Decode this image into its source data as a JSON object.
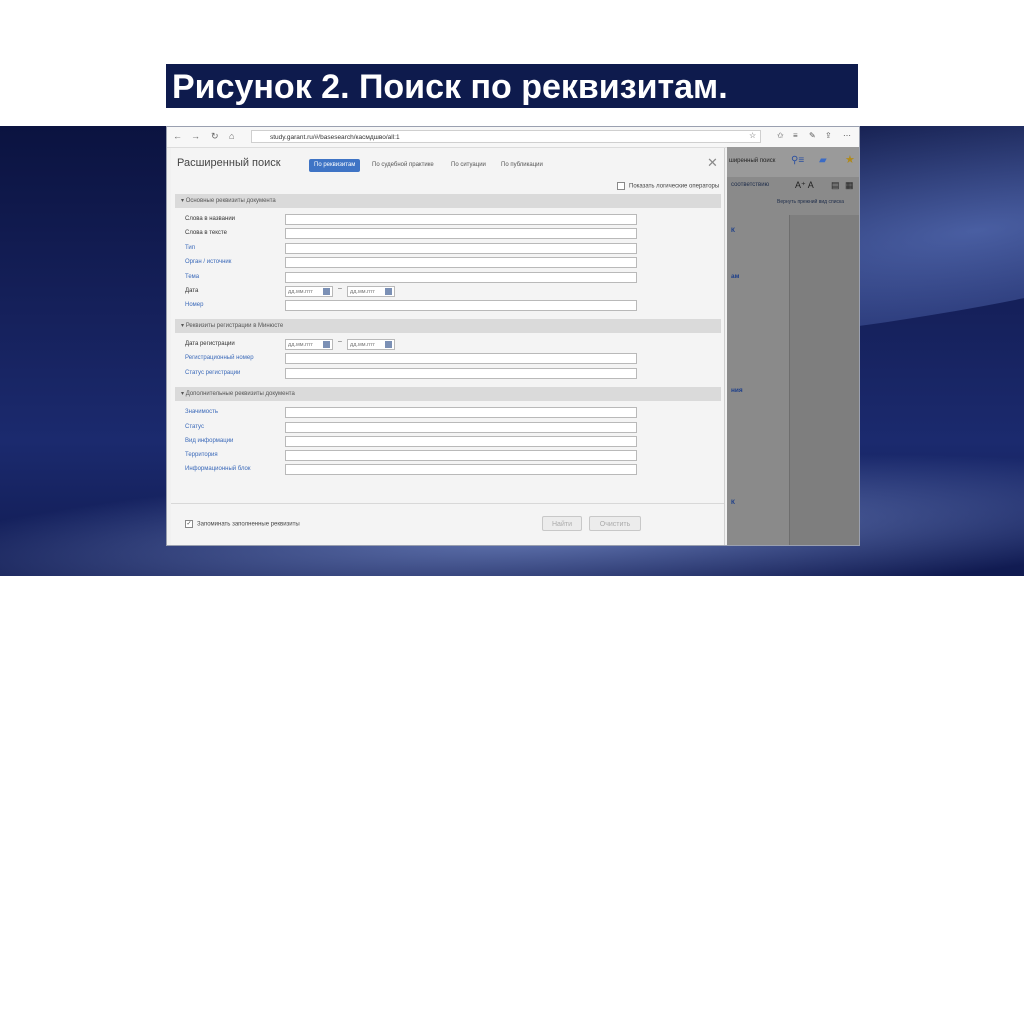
{
  "slide": {
    "title": "Рисунок 2. Поиск по реквизитам."
  },
  "browser": {
    "url": "study.garant.ru/#/basesearch/касмдшво/all:1",
    "nav": [
      "←",
      "→",
      "↻",
      "⌂"
    ]
  },
  "dialog": {
    "title": "Расширенный поиск",
    "tabs": [
      "По реквизитам",
      "По судебной практике",
      "По ситуации",
      "По публикации"
    ],
    "show_operators_label": "Показать логические операторы",
    "sections": [
      {
        "title": "Основные реквизиты документа",
        "rows": [
          {
            "label": "Слова в названии",
            "link": false,
            "type": "text"
          },
          {
            "label": "Слова в тексте",
            "link": false,
            "type": "text"
          },
          {
            "label": "Тип",
            "link": true,
            "type": "text"
          },
          {
            "label": "Орган / источник",
            "link": true,
            "type": "text"
          },
          {
            "label": "Тема",
            "link": true,
            "type": "text"
          },
          {
            "label": "Дата",
            "link": false,
            "type": "date"
          },
          {
            "label": "Номер",
            "link": true,
            "type": "text"
          }
        ]
      },
      {
        "title": "Реквизиты регистрации в Минюсте",
        "rows": [
          {
            "label": "Дата регистрации",
            "link": false,
            "type": "date"
          },
          {
            "label": "Регистрационный номер",
            "link": true,
            "type": "text"
          },
          {
            "label": "Статус регистрации",
            "link": true,
            "type": "text"
          }
        ]
      },
      {
        "title": "Дополнительные реквизиты документа",
        "rows": [
          {
            "label": "Значимость",
            "link": true,
            "type": "text"
          },
          {
            "label": "Статус",
            "link": true,
            "type": "text"
          },
          {
            "label": "Вид информации",
            "link": true,
            "type": "text"
          },
          {
            "label": "Территория",
            "link": true,
            "type": "text"
          },
          {
            "label": "Информационный блок",
            "link": true,
            "type": "text"
          }
        ]
      }
    ],
    "date_placeholder": "дд.мм.гггг",
    "remember_label": "Запоминать заполненные реквизиты",
    "find_button": "Найти",
    "clear_button": "Очистить"
  },
  "background_panel": {
    "header_label": "ширенный поиск",
    "sort_label": "соответствию",
    "font_size_label": "A⁺ A",
    "list_view_link": "Вернуть прежний вид списка"
  }
}
